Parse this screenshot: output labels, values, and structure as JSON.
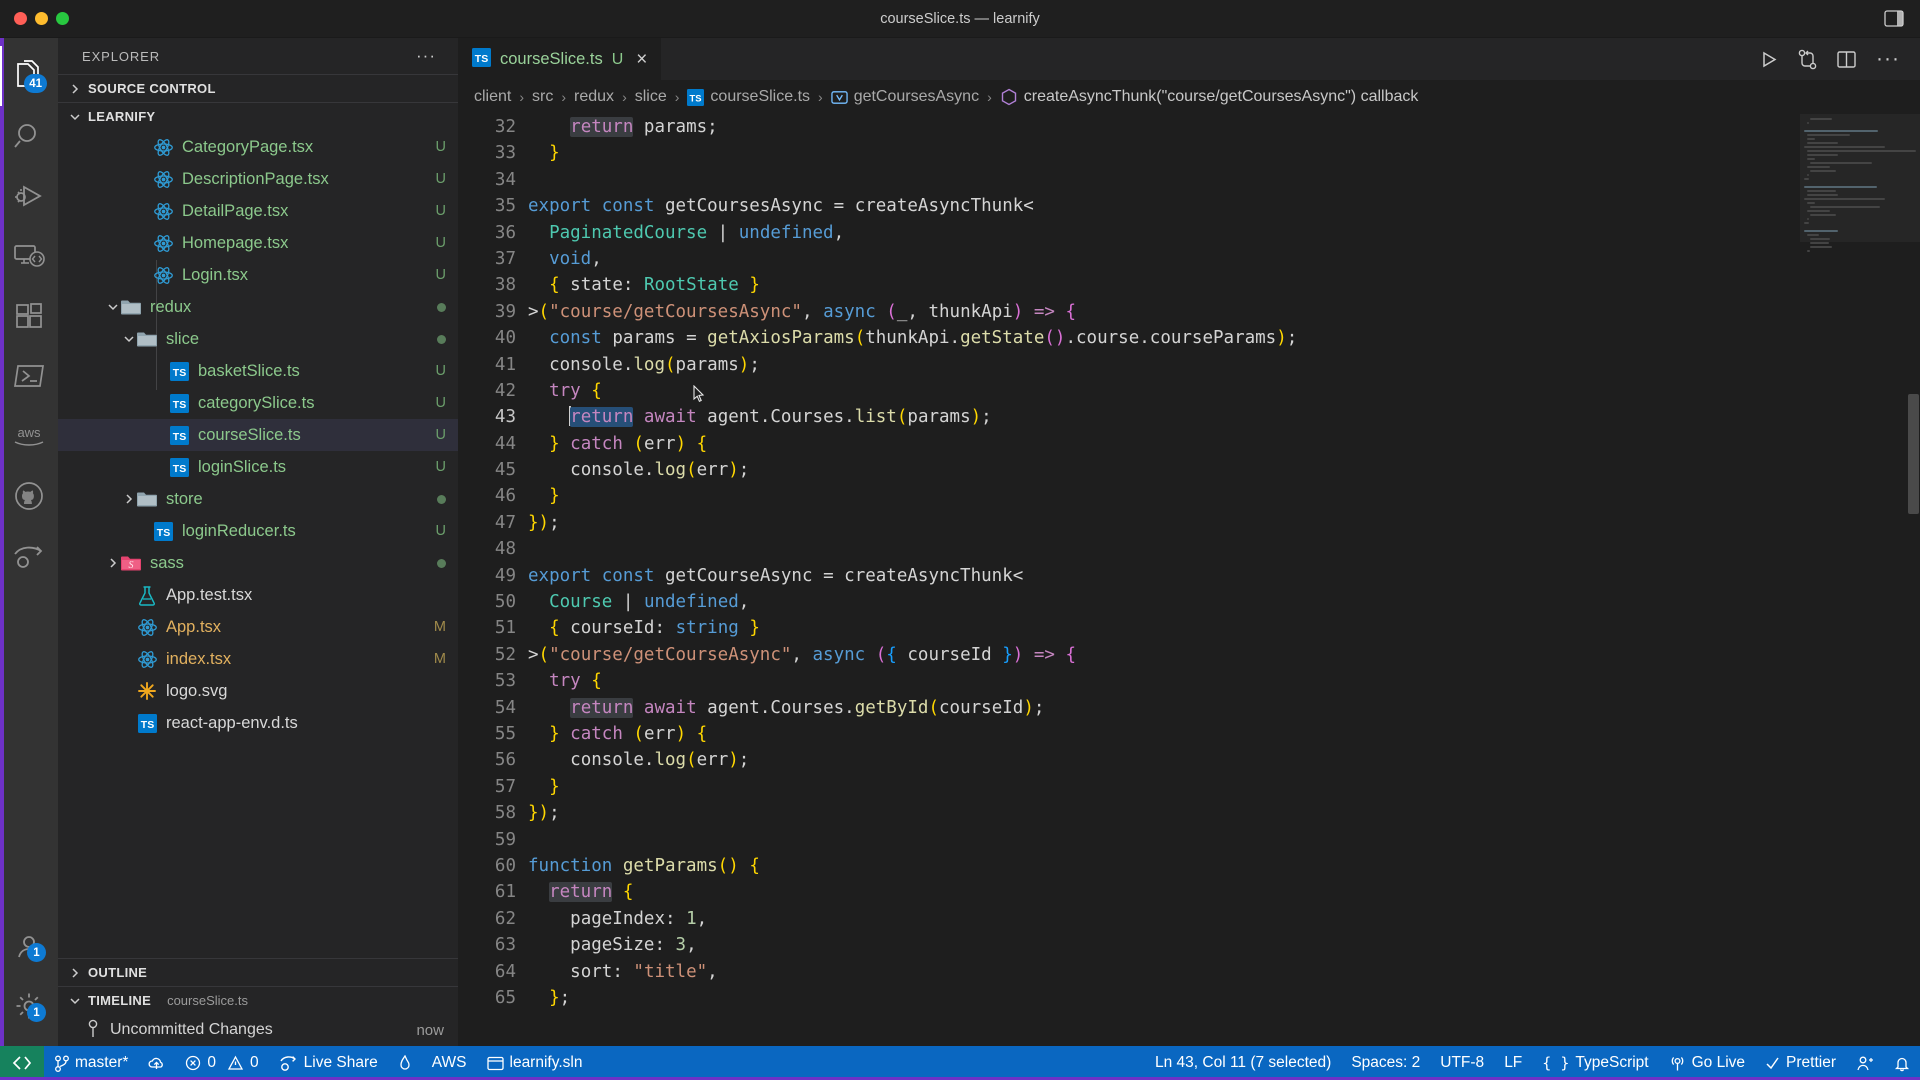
{
  "window": {
    "title": "courseSlice.ts — learnify",
    "traffic_lights": [
      "close",
      "minimize",
      "zoom"
    ]
  },
  "activity_bar": {
    "top_items": [
      {
        "name": "explorer",
        "icon": "files-icon",
        "badge": "41",
        "active": true
      },
      {
        "name": "search",
        "icon": "search-icon",
        "badge": null,
        "active": false
      },
      {
        "name": "run-and-debug",
        "icon": "debug-icon",
        "badge": null,
        "active": false
      },
      {
        "name": "remote-explorer",
        "icon": "remote-icon",
        "badge": null,
        "active": false
      },
      {
        "name": "extensions",
        "icon": "extensions-icon",
        "badge": null,
        "active": false
      },
      {
        "name": "terminal-tasks",
        "icon": "terminal-icon",
        "badge": null,
        "active": false
      },
      {
        "name": "aws-toolkit",
        "icon": "aws-icon",
        "badge": null,
        "active": false
      },
      {
        "name": "github",
        "icon": "github-icon",
        "badge": null,
        "active": false
      },
      {
        "name": "live-share",
        "icon": "live-share-icon",
        "badge": null,
        "active": false
      }
    ],
    "bottom_items": [
      {
        "name": "accounts",
        "icon": "account-icon",
        "badge": "1"
      },
      {
        "name": "settings",
        "icon": "gear-icon",
        "badge": "1"
      }
    ]
  },
  "sidebar": {
    "header": "EXPLORER",
    "more_actions": "···",
    "sections": [
      {
        "name": "source-control",
        "label": "SOURCE CONTROL",
        "expanded": false
      },
      {
        "name": "learnify",
        "label": "LEARNIFY",
        "expanded": true
      }
    ],
    "files": [
      {
        "name": "CategoryPage.tsx",
        "icon": "react-icon",
        "indent": 5,
        "status": "U",
        "color": "green"
      },
      {
        "name": "DescriptionPage.tsx",
        "icon": "react-icon",
        "indent": 5,
        "status": "U",
        "color": "green"
      },
      {
        "name": "DetailPage.tsx",
        "icon": "react-icon",
        "indent": 5,
        "status": "U",
        "color": "green"
      },
      {
        "name": "Homepage.tsx",
        "icon": "react-icon",
        "indent": 5,
        "status": "U",
        "color": "green"
      },
      {
        "name": "Login.tsx",
        "icon": "react-icon",
        "indent": 5,
        "status": "U",
        "color": "green"
      },
      {
        "name": "redux",
        "icon": "folder-icon",
        "indent": 3,
        "status": "dot",
        "color": "green",
        "twisty": "down"
      },
      {
        "name": "slice",
        "icon": "folder-icon",
        "indent": 4,
        "status": "dot",
        "color": "green",
        "twisty": "down"
      },
      {
        "name": "basketSlice.ts",
        "icon": "ts-icon",
        "indent": 6,
        "status": "U",
        "color": "green"
      },
      {
        "name": "categorySlice.ts",
        "icon": "ts-icon",
        "indent": 6,
        "status": "U",
        "color": "green"
      },
      {
        "name": "courseSlice.ts",
        "icon": "ts-icon",
        "indent": 6,
        "status": "U",
        "color": "green",
        "selected": true
      },
      {
        "name": "loginSlice.ts",
        "icon": "ts-icon",
        "indent": 6,
        "status": "U",
        "color": "green"
      },
      {
        "name": "store",
        "icon": "folder-icon",
        "indent": 4,
        "status": "dot",
        "color": "green",
        "twisty": "right"
      },
      {
        "name": "loginReducer.ts",
        "icon": "ts-icon",
        "indent": 5,
        "status": "U",
        "color": "green"
      },
      {
        "name": "sass",
        "icon": "sass-folder-icon",
        "indent": 3,
        "status": "dot",
        "color": "green",
        "twisty": "right"
      },
      {
        "name": "App.test.tsx",
        "icon": "test-icon",
        "indent": 4,
        "status": "",
        "color": "white"
      },
      {
        "name": "App.tsx",
        "icon": "react-icon",
        "indent": 4,
        "status": "M",
        "color": "orange"
      },
      {
        "name": "index.tsx",
        "icon": "react-icon",
        "indent": 4,
        "status": "M",
        "color": "orange"
      },
      {
        "name": "logo.svg",
        "icon": "svg-icon",
        "indent": 4,
        "status": "",
        "color": "white"
      },
      {
        "name": "react-app-env.d.ts",
        "icon": "ts-icon",
        "indent": 4,
        "status": "",
        "color": "white"
      }
    ],
    "outline": {
      "label": "OUTLINE",
      "expanded": false
    },
    "timeline": {
      "label": "TIMELINE",
      "subtitle": "courseSlice.ts",
      "expanded": true,
      "entries": [
        {
          "label": "Uncommitted Changes",
          "when": "now",
          "icon": "git-commit-icon"
        }
      ]
    }
  },
  "editor": {
    "tab": {
      "filename": "courseSlice.ts",
      "status": "U",
      "icon": "ts-icon",
      "close": "×"
    },
    "actions": [
      {
        "name": "run-file",
        "icon": "play-icon"
      },
      {
        "name": "source-control-compare",
        "icon": "git-compare-icon"
      },
      {
        "name": "split-editor",
        "icon": "split-editor-icon"
      },
      {
        "name": "more-actions",
        "icon": "ellipsis-icon"
      }
    ],
    "breadcrumb": [
      {
        "label": "client",
        "icon": null
      },
      {
        "label": "src",
        "icon": null
      },
      {
        "label": "redux",
        "icon": null
      },
      {
        "label": "slice",
        "icon": null
      },
      {
        "label": "courseSlice.ts",
        "icon": "ts-icon"
      },
      {
        "label": "getCoursesAsync",
        "icon": "variable-icon"
      },
      {
        "label": "createAsyncThunk(\"course/getCoursesAsync\") callback",
        "icon": "function-icon"
      }
    ],
    "first_line_number": 32,
    "lines": [
      {
        "n": 32,
        "text": "    return params;"
      },
      {
        "n": 33,
        "text": "  }"
      },
      {
        "n": 34,
        "text": ""
      },
      {
        "n": 35,
        "text": "export const getCoursesAsync = createAsyncThunk<"
      },
      {
        "n": 36,
        "text": "  PaginatedCourse | undefined,"
      },
      {
        "n": 37,
        "text": "  void,"
      },
      {
        "n": 38,
        "text": "  { state: RootState }"
      },
      {
        "n": 39,
        "text": ">(\"course/getCoursesAsync\", async (_, thunkApi) => {"
      },
      {
        "n": 40,
        "text": "  const params = getAxiosParams(thunkApi.getState().course.courseParams);"
      },
      {
        "n": 41,
        "text": "  console.log(params);"
      },
      {
        "n": 42,
        "text": "  try {"
      },
      {
        "n": 43,
        "text": "    return await agent.Courses.list(params);"
      },
      {
        "n": 44,
        "text": "  } catch (err) {"
      },
      {
        "n": 45,
        "text": "    console.log(err);"
      },
      {
        "n": 46,
        "text": "  }"
      },
      {
        "n": 47,
        "text": "});"
      },
      {
        "n": 48,
        "text": ""
      },
      {
        "n": 49,
        "text": "export const getCourseAsync = createAsyncThunk<"
      },
      {
        "n": 50,
        "text": "  Course | undefined,"
      },
      {
        "n": 51,
        "text": "  { courseId: string }"
      },
      {
        "n": 52,
        "text": ">(\"course/getCourseAsync\", async ({ courseId }) => {"
      },
      {
        "n": 53,
        "text": "  try {"
      },
      {
        "n": 54,
        "text": "    return await agent.Courses.getById(courseId);"
      },
      {
        "n": 55,
        "text": "  } catch (err) {"
      },
      {
        "n": 56,
        "text": "    console.log(err);"
      },
      {
        "n": 57,
        "text": "  }"
      },
      {
        "n": 58,
        "text": "});"
      },
      {
        "n": 59,
        "text": ""
      },
      {
        "n": 60,
        "text": "function getParams() {"
      },
      {
        "n": 61,
        "text": "  return {"
      },
      {
        "n": 62,
        "text": "    pageIndex: 1,"
      },
      {
        "n": 63,
        "text": "    pageSize: 3,"
      },
      {
        "n": 64,
        "text": "    sort: \"title\","
      },
      {
        "n": 65,
        "text": "  };"
      }
    ],
    "selection": {
      "line": 43,
      "text": "return"
    }
  },
  "status_bar": {
    "remote_icon": "remote-window-icon",
    "left": [
      {
        "name": "branch",
        "icon": "source-control-icon",
        "label": "master*"
      },
      {
        "name": "sync-changes",
        "icon": "cloud-upload-icon",
        "label": ""
      },
      {
        "name": "problems",
        "icon": "error-warning-icon",
        "label": "0",
        "label2": "0"
      },
      {
        "name": "live-share",
        "icon": "live-share-icon",
        "label": "Live Share"
      },
      {
        "name": "sonarlint",
        "icon": "flame-icon",
        "label": ""
      },
      {
        "name": "aws",
        "icon": null,
        "label": "AWS"
      },
      {
        "name": "solution",
        "icon": "window-icon",
        "label": "learnify.sln"
      }
    ],
    "right": [
      {
        "name": "cursor-position",
        "label": "Ln 43, Col 11 (7 selected)"
      },
      {
        "name": "indentation",
        "label": "Spaces: 2"
      },
      {
        "name": "encoding",
        "label": "UTF-8"
      },
      {
        "name": "eol",
        "label": "LF"
      },
      {
        "name": "language-mode",
        "icon": "braces-icon",
        "label": "TypeScript"
      },
      {
        "name": "go-live",
        "icon": "broadcast-icon",
        "label": "Go Live"
      },
      {
        "name": "prettier",
        "icon": "check-icon",
        "label": "Prettier"
      },
      {
        "name": "remote-collab",
        "icon": "person-share-icon",
        "label": ""
      },
      {
        "name": "notifications",
        "icon": "bell-icon",
        "label": ""
      }
    ]
  },
  "colors": {
    "accent_blue": "#0a67c1",
    "remote_green": "#16825d",
    "badge_blue": "#0e7ad3",
    "selection_blue": "#264f78",
    "purple_edge": "#6e31c7",
    "editor_bg": "#1e1e1e",
    "sidebar_bg": "#252526",
    "activitybar_bg": "#333333"
  }
}
